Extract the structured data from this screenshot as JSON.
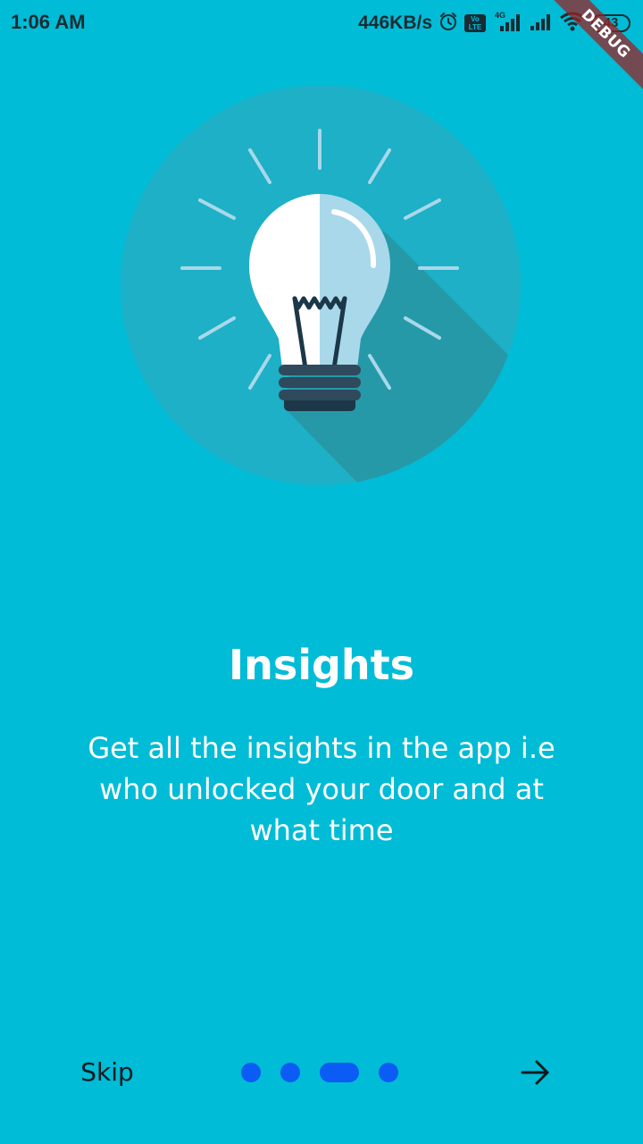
{
  "status_bar": {
    "time": "1:06 AM",
    "net_speed": "446KB/s",
    "volte_label": "Vo LTE",
    "network_type": "4G",
    "battery": "43",
    "icons": [
      "alarm-icon",
      "volte-icon",
      "signal-icon",
      "signal-icon",
      "wifi-icon",
      "battery-icon"
    ]
  },
  "debug_banner": "DEBUG",
  "onboarding": {
    "illustration": "lightbulb-icon",
    "title": "Insights",
    "description": "Get all the insights in the app i.e who unlocked your door and at what time"
  },
  "navigation": {
    "skip_label": "Skip",
    "next_icon": "arrow-right-icon",
    "page_count": 4,
    "current_page": 3
  },
  "colors": {
    "background": "#00BCD6",
    "circle": "#1DB0C6",
    "shadow": "#2699A9",
    "indicator": "#0B5BF5",
    "bulb_left": "#FFFFFF",
    "bulb_right": "#A9D8EA",
    "bulb_base": "#1B3748"
  }
}
